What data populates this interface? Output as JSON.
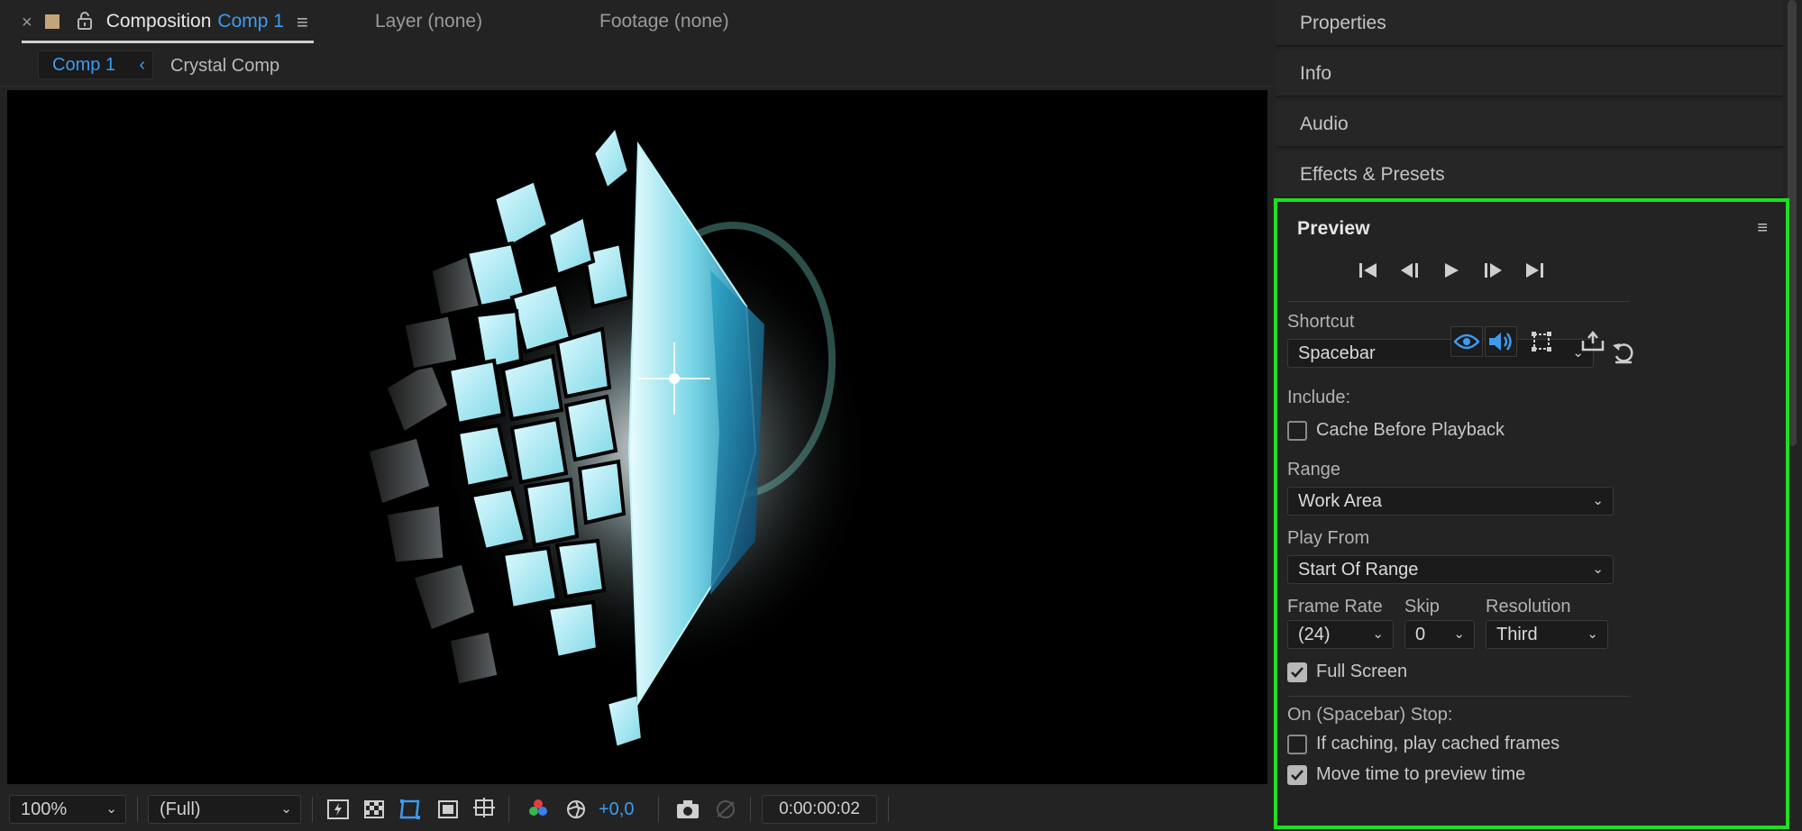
{
  "composition_panel": {
    "tabs": {
      "close_glyph": "×",
      "composition_label": "Composition",
      "composition_name": "Comp 1",
      "layer_label": "Layer (none)",
      "footage_label": "Footage (none)"
    },
    "breadcrumbs": {
      "active": "Comp 1",
      "next": "Crystal Comp"
    },
    "toolbar": {
      "zoom": "100%",
      "resolution": "(Full)",
      "exposure": "+0,0",
      "timecode": "0:00:00:02"
    }
  },
  "right_panels": {
    "collapsed": [
      "Properties",
      "Info",
      "Audio",
      "Effects & Presets"
    ]
  },
  "preview": {
    "title": "Preview",
    "shortcut_label": "Shortcut",
    "shortcut_value": "Spacebar",
    "include_label": "Include:",
    "cache_label": "Cache Before Playback",
    "cache_checked": false,
    "range_label": "Range",
    "range_value": "Work Area",
    "play_from_label": "Play From",
    "play_from_value": "Start Of Range",
    "frame_rate_label": "Frame Rate",
    "frame_rate_value": "(24)",
    "skip_label": "Skip",
    "skip_value": "0",
    "resolution_label": "Resolution",
    "resolution_value": "Third",
    "full_screen_label": "Full Screen",
    "full_screen_checked": true,
    "stop_label": "On (Spacebar) Stop:",
    "cached_frames_label": "If caching, play cached frames",
    "cached_frames_checked": false,
    "move_time_label": "Move time to preview time",
    "move_time_checked": true
  },
  "colors": {
    "accent_blue": "#3d9bf0",
    "highlight_green": "#1fe01f",
    "panel_bg": "#232323",
    "viewer_bg": "#000000",
    "crystal_cyan": "#7fe6ef"
  }
}
